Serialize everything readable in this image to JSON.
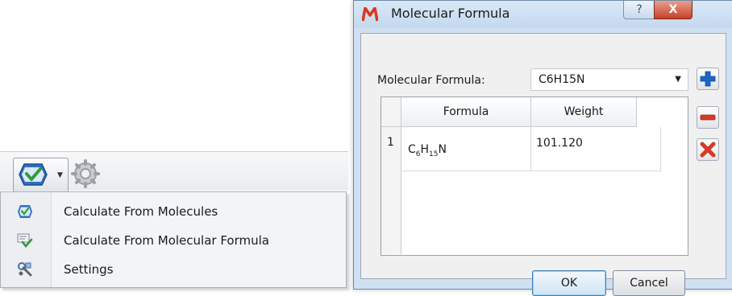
{
  "toolbar": {
    "calculate_icon": "shield-check-icon",
    "dropdown_icon": "chevron-down-icon",
    "settings_icon": "gear-icon"
  },
  "menu": {
    "items": [
      {
        "label": "Calculate From Molecules",
        "icon": "shield-check-icon"
      },
      {
        "label": "Calculate From Molecular Formula",
        "icon": "formula-check-icon"
      },
      {
        "label": "Settings",
        "icon": "wrench-icon"
      }
    ]
  },
  "dialog": {
    "title": "Molecular Formula",
    "help_label": "?",
    "close_label": "X",
    "formula_label": "Molecular Formula:",
    "formula_value": "C6H15N",
    "table": {
      "columns": [
        "Formula",
        "Weight"
      ],
      "rows": [
        {
          "num": "1",
          "formula": {
            "c": "C",
            "c_sub": "6",
            "h": "H",
            "h_sub": "15",
            "n": "N"
          },
          "weight": "101.120"
        }
      ]
    },
    "ok_label": "OK",
    "cancel_label": "Cancel"
  },
  "colors": {
    "accent": "#1b64c8",
    "remove": "#d63a2a",
    "icon_green": "#3aa34a"
  }
}
